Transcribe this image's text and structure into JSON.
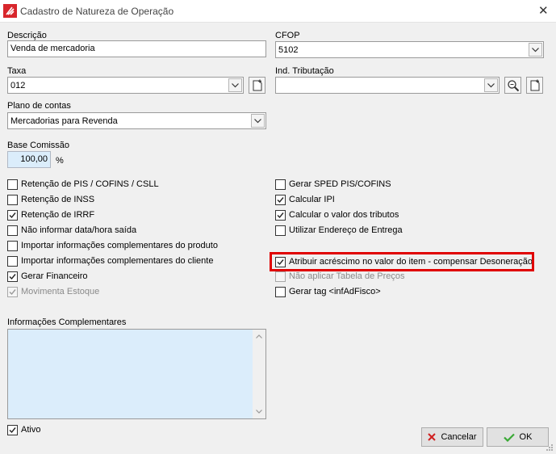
{
  "window": {
    "title": "Cadastro de Natureza de Operação"
  },
  "fields": {
    "descricao": {
      "label": "Descrição",
      "value": "Venda de mercadoria"
    },
    "cfop": {
      "label": "CFOP",
      "value": "5102"
    },
    "taxa": {
      "label": "Taxa",
      "value": "012"
    },
    "ind_tributacao": {
      "label": "Ind. Tributação",
      "value": ""
    },
    "plano_contas": {
      "label": "Plano de contas",
      "value": "Mercadorias para Revenda"
    },
    "base_comissao": {
      "label": "Base Comissão",
      "value": "100,00",
      "unit": "%"
    },
    "info_complementares": {
      "label": "Informações Complementares",
      "value": ""
    }
  },
  "left_checks": [
    {
      "label": "Retenção de PIS / COFINS / CSLL",
      "checked": false,
      "disabled": false
    },
    {
      "label": "Retenção de INSS",
      "checked": false,
      "disabled": false
    },
    {
      "label": "Retenção de IRRF",
      "checked": true,
      "disabled": false
    },
    {
      "label": "Não informar data/hora saída",
      "checked": false,
      "disabled": false
    },
    {
      "label": "Importar informações complementares do produto",
      "checked": false,
      "disabled": false
    },
    {
      "label": "Importar informações complementares do cliente",
      "checked": false,
      "disabled": false
    },
    {
      "label": "Gerar Financeiro",
      "checked": true,
      "disabled": false
    },
    {
      "label": "Movimenta Estoque",
      "checked": true,
      "disabled": true
    }
  ],
  "right_checks": [
    {
      "label": "Gerar SPED PIS/COFINS",
      "checked": false,
      "disabled": false
    },
    {
      "label": "Calcular IPI",
      "checked": true,
      "disabled": false
    },
    {
      "label": "Calcular o valor dos tributos",
      "checked": true,
      "disabled": false
    },
    {
      "label": "Utilizar Endereço de Entrega",
      "checked": false,
      "disabled": false
    },
    {
      "label": "Atribuir acréscimo no valor do item - compensar Desoneração",
      "checked": true,
      "disabled": false
    },
    {
      "label": "Não aplicar Tabela de Preços",
      "checked": false,
      "disabled": true
    },
    {
      "label": "Gerar tag <infAdFisco>",
      "checked": false,
      "disabled": false
    }
  ],
  "ativo": {
    "label": "Ativo",
    "checked": true
  },
  "buttons": {
    "cancel": "Cancelar",
    "ok": "OK"
  },
  "colors": {
    "highlight": "#e00000",
    "memo_bg": "#dbedfb",
    "ok_check": "#3aa935",
    "cancel_x": "#d02020"
  }
}
